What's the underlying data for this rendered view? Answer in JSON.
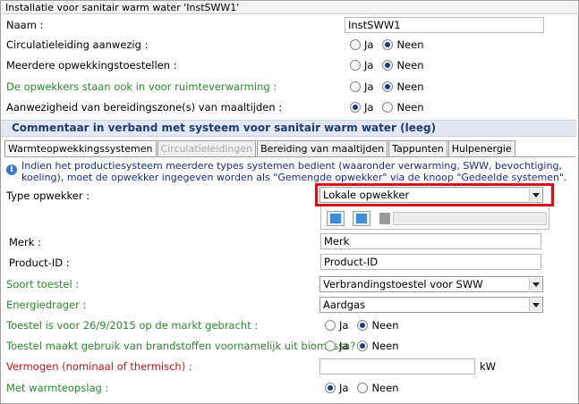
{
  "window": {
    "title": "Installatie voor sanitair warm water 'InstSWW1'"
  },
  "top": {
    "naam_label": "Naam :",
    "naam_value": "InstSWW1",
    "circulatie_label": "Circulatieleiding aanwezig :",
    "meerdere_label": "Meerdere opwekkingstoestellen :",
    "ruimte_label": "De opwekkers staan ook in voor ruimteverwarming :",
    "zone_label": "Aanwezigheid van bereidingszone(s) van maaltijden :",
    "ja": "Ja",
    "neen": "Neen"
  },
  "section": {
    "title": "Commentaar in verband met systeem voor sanitair warm water  (leeg)"
  },
  "tabs": [
    {
      "label": "Warmteopwekkingssystemen",
      "state": "active"
    },
    {
      "label": "Circulatieleidingen",
      "state": "disabled"
    },
    {
      "label": "Bereiding van maaltijden",
      "state": "normal"
    },
    {
      "label": "Tappunten",
      "state": "normal"
    },
    {
      "label": "Hulpenergie",
      "state": "normal"
    }
  ],
  "info": {
    "text": "Indien het productiesysteem meerdere types systemen bedient (waaronder verwarming, SWW, bevochtiging, koeling), moet de opwekker ingegeven worden als \"Gemengde opwekker\" via de knoop \"Gedeelde systemen\"."
  },
  "form": {
    "type_label": "Type opwekker :",
    "type_value": "Lokale opwekker",
    "merk_label": "Merk :",
    "merk_value": "Merk",
    "product_label": "Product-ID :",
    "product_value": "Product-ID",
    "soort_label": "Soort toestel :",
    "soort_value": "Verbrandingstoestel voor SWW",
    "energie_label": "Energiedrager :",
    "energie_value": "Aardgas",
    "markt_label": "Toestel is voor 26/9/2015 op de markt gebracht :",
    "biomassa_label": "Toestel maakt gebruik van brandstoffen voornamelijk uit biomassa? :",
    "vermogen_label": "Vermogen (nominaal of thermisch) :",
    "vermogen_value": "",
    "vermogen_unit": "kW",
    "opslag_label": "Met warmteopslag  :"
  },
  "radios": {
    "circulatie": "Neen",
    "meerdere": "Neen",
    "ruimte": "Neen",
    "zone": "Ja",
    "markt": "Neen",
    "biomassa": "Neen",
    "opslag": "Ja"
  },
  "colors": {
    "required_green": "#2b8a2b",
    "error_red": "#cc1111",
    "highlight": "#d4111a",
    "section_text": "#1f3b73"
  }
}
